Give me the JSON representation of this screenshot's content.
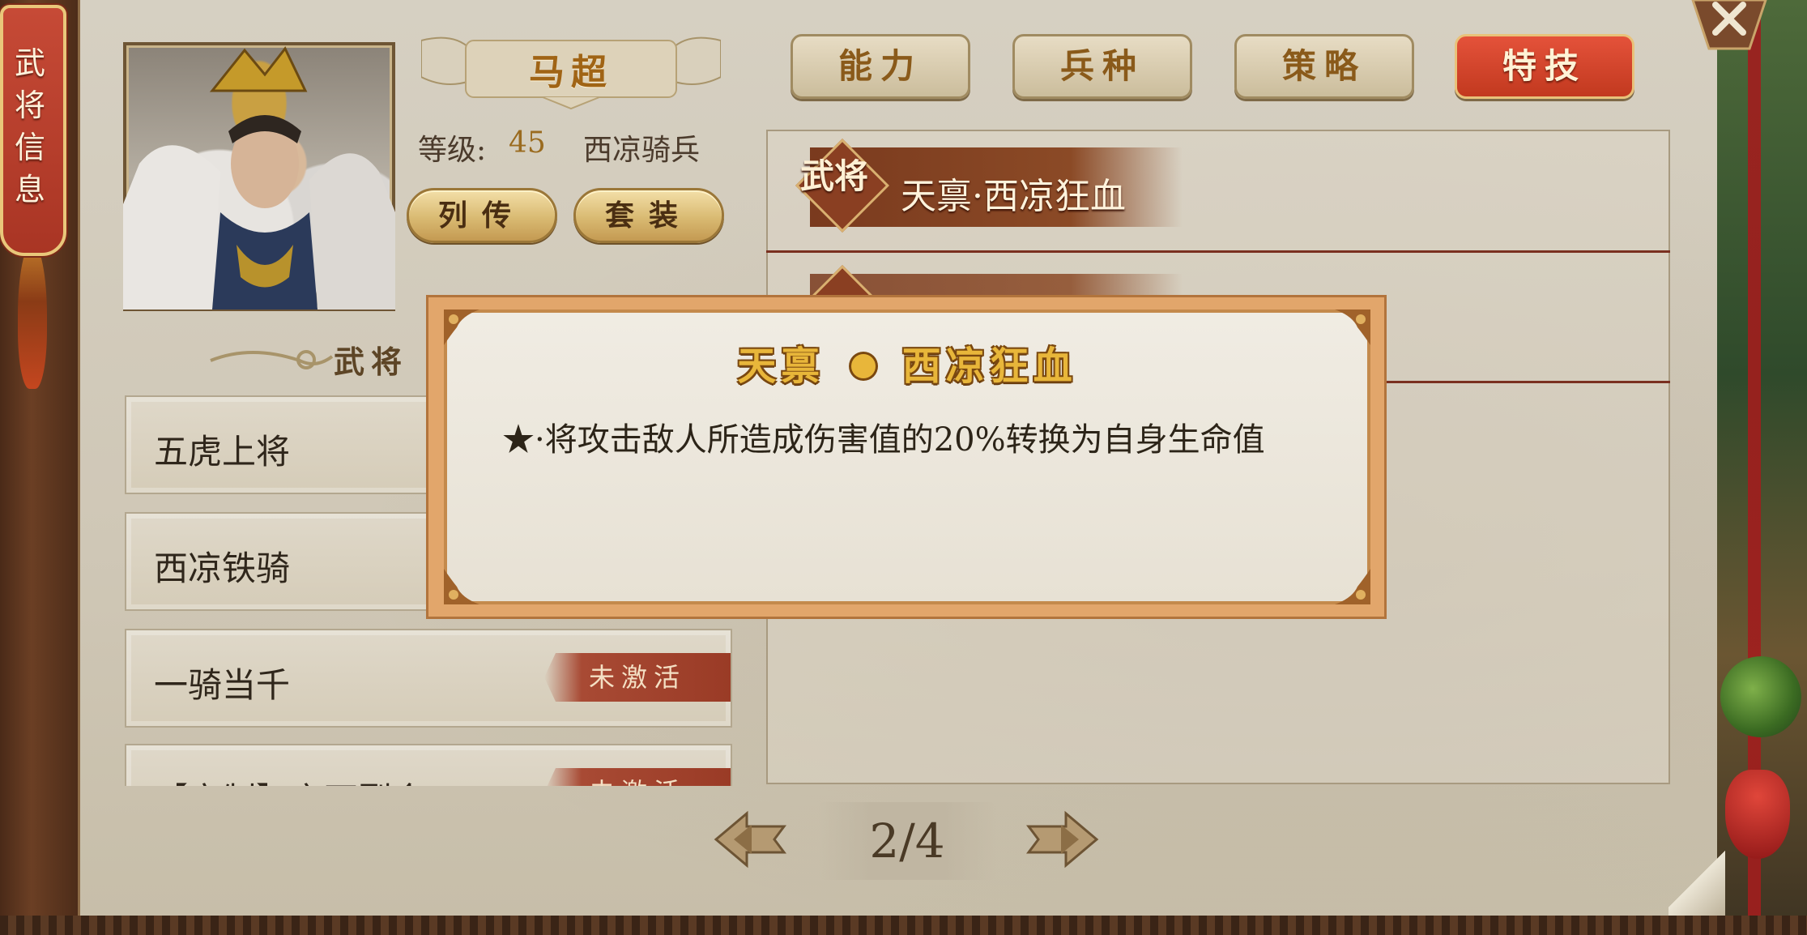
{
  "side_tab": {
    "label": "武将信息"
  },
  "hero": {
    "name": "马超",
    "level_label": "等级:",
    "level": "45",
    "troop_type": "西凉骑兵"
  },
  "buttons": {
    "biography": "列传",
    "equipment_set": "套装"
  },
  "tabs": [
    {
      "label": "能力",
      "active": false
    },
    {
      "label": "兵种",
      "active": false
    },
    {
      "label": "策略",
      "active": false
    },
    {
      "label": "特技",
      "active": true
    }
  ],
  "skills": {
    "row1": {
      "badge": "武将",
      "name": "天禀·西凉狂血"
    }
  },
  "fetters": {
    "title": "武将",
    "items": [
      {
        "label": "五虎上将"
      },
      {
        "label": "西凉铁骑"
      },
      {
        "label": "一骑当千",
        "status": "未激活"
      },
      {
        "label": "【定制】穿石裂金",
        "status": "未激活"
      }
    ]
  },
  "pager": {
    "indicator": "2/4"
  },
  "popup": {
    "title_left": "天禀",
    "title_right": "西凉狂血",
    "description": "★·将攻击敌人所造成伤害值的20%转换为自身生命值"
  },
  "colors": {
    "accent_red": "#c2391f",
    "gold": "#d9ba72",
    "parchment": "#d6d0c2",
    "title_gold": "#e8b63a"
  }
}
